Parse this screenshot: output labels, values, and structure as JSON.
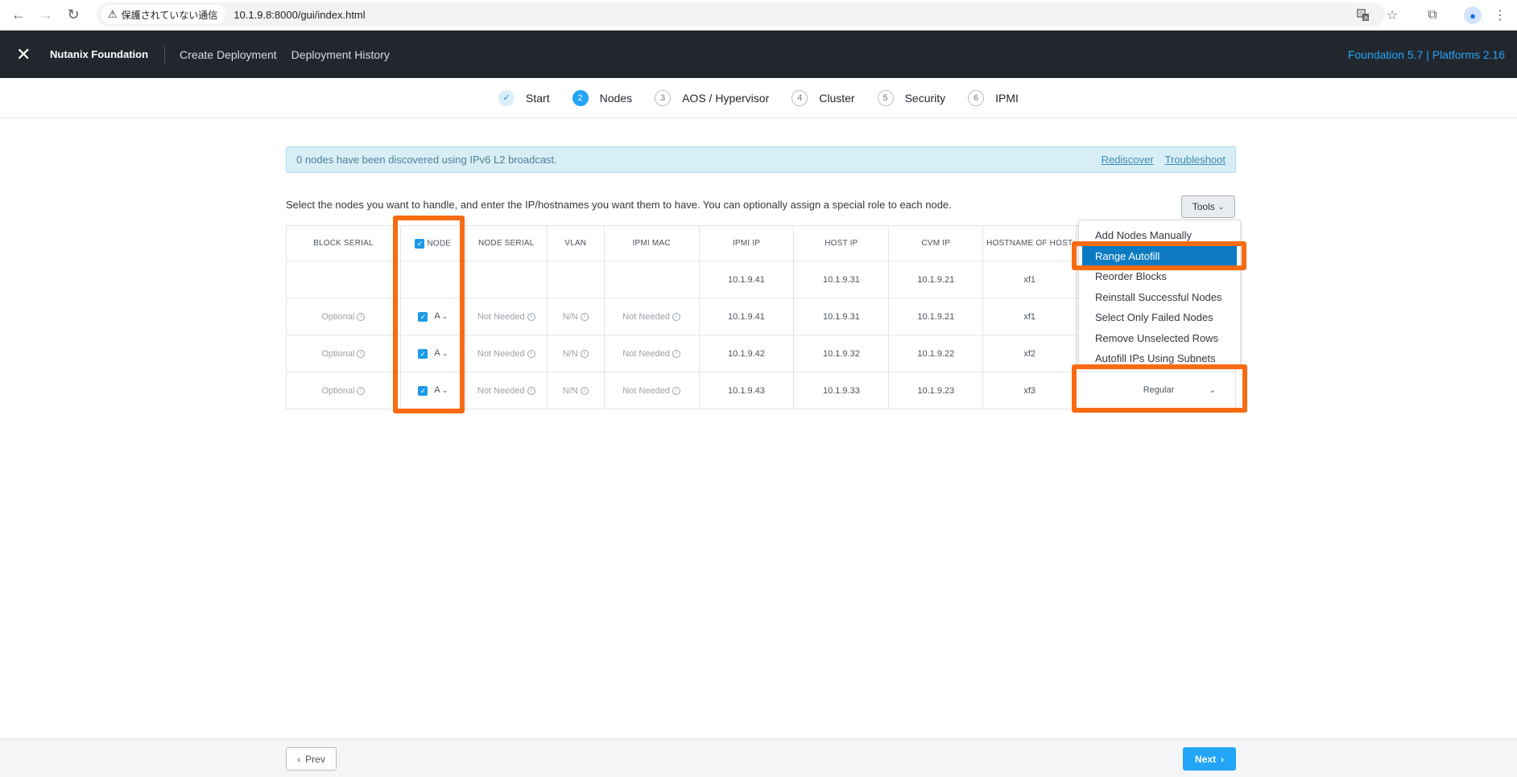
{
  "browser": {
    "security_label": "保護されていない通信",
    "url": "10.1.9.8:8000/gui/index.html",
    "back": "←",
    "forward": "→",
    "reload": "↻",
    "translate_icon": "translate-icon",
    "bookmark_star": "☆",
    "extensions": "⧉",
    "menu": "⋮",
    "warning_glyph": "⚠"
  },
  "app": {
    "logo_glyph": "✕",
    "brand": "Nutanix Foundation",
    "nav": [
      "Create Deployment",
      "Deployment History"
    ],
    "version": "Foundation 5.7 | Platforms 2.16"
  },
  "steps": [
    {
      "num": "✓",
      "label": "Start",
      "state": "done"
    },
    {
      "num": "2",
      "label": "Nodes",
      "state": "active"
    },
    {
      "num": "3",
      "label": "AOS / Hypervisor",
      "state": "todo"
    },
    {
      "num": "4",
      "label": "Cluster",
      "state": "todo"
    },
    {
      "num": "5",
      "label": "Security",
      "state": "todo"
    },
    {
      "num": "6",
      "label": "IPMI",
      "state": "todo"
    }
  ],
  "alert": {
    "message": "0 nodes have been discovered using IPv6 L2 broadcast.",
    "rediscover": "Rediscover",
    "troubleshoot": "Troubleshoot"
  },
  "instructions": "Select the nodes you want to handle, and enter the IP/hostnames you want them to have. You can optionally assign a special role to each node.",
  "tools": {
    "label": "Tools",
    "menu_items": [
      "Add Nodes Manually",
      "Range Autofill",
      "Reorder Blocks",
      "Reinstall Successful Nodes",
      "Select Only Failed Nodes",
      "Remove Unselected Rows",
      "Autofill IPs Using Subnets"
    ],
    "selected_index": 1
  },
  "table": {
    "headers": [
      "BLOCK SERIAL",
      "NODE",
      "NODE SERIAL",
      "VLAN",
      "IPMI MAC",
      "IPMI IP",
      "HOST IP",
      "CVM IP",
      "HOSTNAME OF HOST"
    ],
    "autofill_row": {
      "ipmi_ip": "10.1.9.41",
      "host_ip": "10.1.9.31",
      "cvm_ip": "10.1.9.21",
      "hostname": "xf1"
    },
    "rows": [
      {
        "block_serial": "Optional",
        "node": "A",
        "node_serial": "Not Needed",
        "vlan": "N/N",
        "ipmi_mac": "Not Needed",
        "ipmi_ip": "10.1.9.41",
        "host_ip": "10.1.9.31",
        "cvm_ip": "10.1.9.21",
        "hostname": "xf1"
      },
      {
        "block_serial": "Optional",
        "node": "A",
        "node_serial": "Not Needed",
        "vlan": "N/N",
        "ipmi_mac": "Not Needed",
        "ipmi_ip": "10.1.9.42",
        "host_ip": "10.1.9.32",
        "cvm_ip": "10.1.9.22",
        "hostname": "xf2"
      },
      {
        "block_serial": "Optional",
        "node": "A",
        "node_serial": "Not Needed",
        "vlan": "N/N",
        "ipmi_mac": "Not Needed",
        "ipmi_ip": "10.1.9.43",
        "host_ip": "10.1.9.33",
        "cvm_ip": "10.1.9.23",
        "hostname": "xf3"
      }
    ],
    "role_value": "Regular"
  },
  "footer": {
    "prev": "Prev",
    "next": "Next"
  },
  "colors": {
    "accent": "#22a5f7",
    "highlight": "#f96b12",
    "header_bg": "#22272e",
    "menu_selected": "#0d7bc4"
  }
}
